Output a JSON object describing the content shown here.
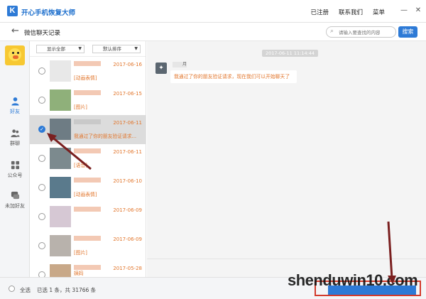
{
  "app": {
    "title": "开心手机恢复大师",
    "logo_letter": "K",
    "top_links": [
      "已注册",
      "联系我们",
      "菜单"
    ],
    "accent": "#2d7ad6"
  },
  "subheader": {
    "back_icon": "arrow-left-icon",
    "title": "微信聊天记录",
    "search_placeholder": "请输入要查找的内容",
    "search_button": "搜索"
  },
  "nav": {
    "items": [
      {
        "label": "好友",
        "icon": "person-icon",
        "active": true
      },
      {
        "label": "群聊",
        "icon": "group-icon",
        "active": false
      },
      {
        "label": "公众号",
        "icon": "grid-icon",
        "active": false
      },
      {
        "label": "未加好友",
        "icon": "chat-bubble-icon",
        "active": false
      }
    ]
  },
  "filters": {
    "show": "显示全部",
    "sort": "默认排序"
  },
  "contacts": [
    {
      "date": "2017-06-16",
      "msg": "[动画表情]",
      "selected": false,
      "thumb": "#d8d8d8"
    },
    {
      "date": "2017-06-15",
      "msg": "[图片]",
      "selected": false,
      "thumb": "#8fb07a"
    },
    {
      "date": "2017-06-11",
      "msg": "我通过了你的朋友验证请求...",
      "selected": true,
      "thumb": "#6e7c84"
    },
    {
      "date": "2017-06-11",
      "msg": "[语音]",
      "selected": false,
      "thumb": "#7c8a8e"
    },
    {
      "date": "2017-06-10",
      "msg": "[动画表情]",
      "selected": false,
      "thumb": "#5a7a8c"
    },
    {
      "date": "2017-06-09",
      "msg": "",
      "selected": false,
      "thumb": "#d6c8d4"
    },
    {
      "date": "2017-06-09",
      "msg": "[图片]",
      "selected": false,
      "thumb": "#b8b2ac"
    },
    {
      "date": "2017-05-28",
      "msg": "姨妈",
      "selected": false,
      "thumb": "#c8a888"
    }
  ],
  "chat": {
    "timestamp": "2017-06-11 11:14:44",
    "sender_tail": "月",
    "message": "我通过了你的朋友验证请求，现在我们可以开始聊天了"
  },
  "bottom": {
    "select_all": "全选",
    "selected_info": "已选 1 条，共 31766 条"
  },
  "watermark": "shenduwin10.com"
}
